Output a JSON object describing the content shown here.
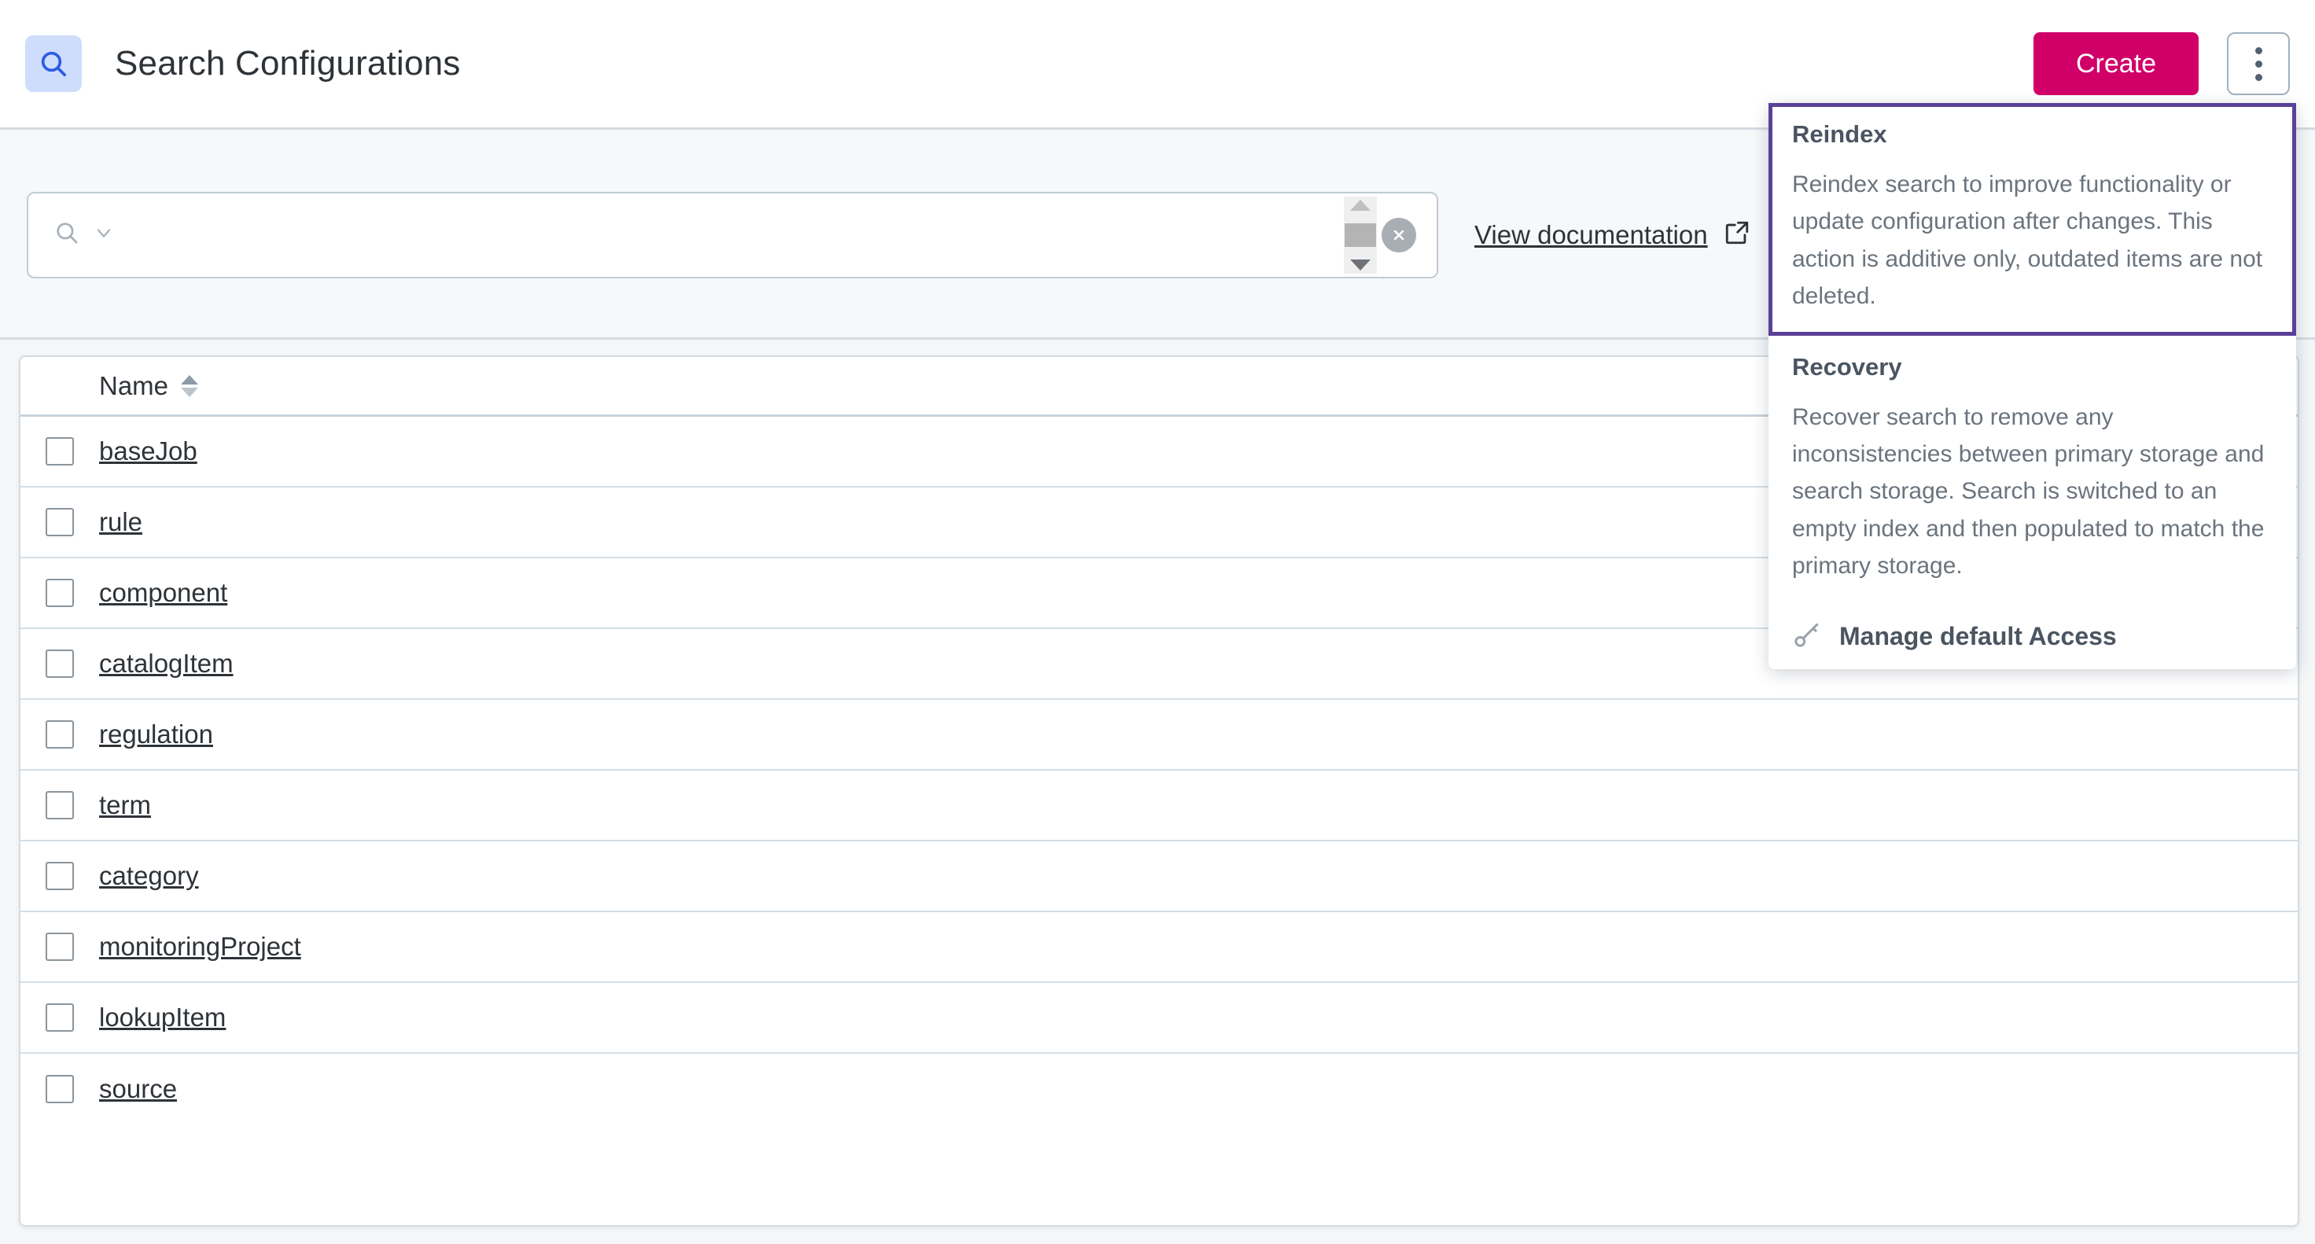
{
  "header": {
    "icon": "search-icon",
    "title": "Search Configurations",
    "create_label": "Create",
    "overflow_menu_icon": "kebab-menu-icon"
  },
  "toolbar": {
    "search": {
      "icon": "search-icon",
      "dropdown_icon": "chevron-down-icon",
      "value": "",
      "placeholder": "",
      "clear_icon": "clear-circle-icon",
      "scrollbar": {
        "up_icon": "triangle-up-icon",
        "down_icon": "triangle-down-icon"
      }
    },
    "documentation_link": {
      "label": "View documentation",
      "icon": "external-link-icon"
    }
  },
  "table": {
    "columns": [
      {
        "key": "select",
        "label": ""
      },
      {
        "key": "name",
        "label": "Name",
        "sortable": true,
        "sort_icon": "sort-arrows-icon"
      }
    ],
    "rows": [
      {
        "name": "baseJob",
        "selected": false
      },
      {
        "name": "rule",
        "selected": false
      },
      {
        "name": "component",
        "selected": false
      },
      {
        "name": "catalogItem",
        "selected": false
      },
      {
        "name": "regulation",
        "selected": false
      },
      {
        "name": "term",
        "selected": false
      },
      {
        "name": "category",
        "selected": false
      },
      {
        "name": "monitoringProject",
        "selected": false
      },
      {
        "name": "lookupItem",
        "selected": false
      },
      {
        "name": "source",
        "selected": false
      }
    ]
  },
  "dropdown": {
    "items": [
      {
        "title": "Reindex",
        "description": "Reindex search to improve functionality or update configuration after changes. This action is additive only, outdated items are not deleted.",
        "focused": true
      },
      {
        "title": "Recovery",
        "description": "Recover search to remove any inconsistencies between primary storage and search storage. Search is switched to an empty index and then populated to match the primary storage.",
        "focused": false
      }
    ],
    "action": {
      "label": "Manage default Access",
      "icon": "key-icon"
    }
  },
  "colors": {
    "accent_create": "#D10069",
    "focus_outline": "#5B4099",
    "header_icon_bg": "#CEDDFC",
    "header_icon_fg": "#2B5CE6",
    "page_bg": "#F4F6F8",
    "border": "#D5DBE0"
  }
}
